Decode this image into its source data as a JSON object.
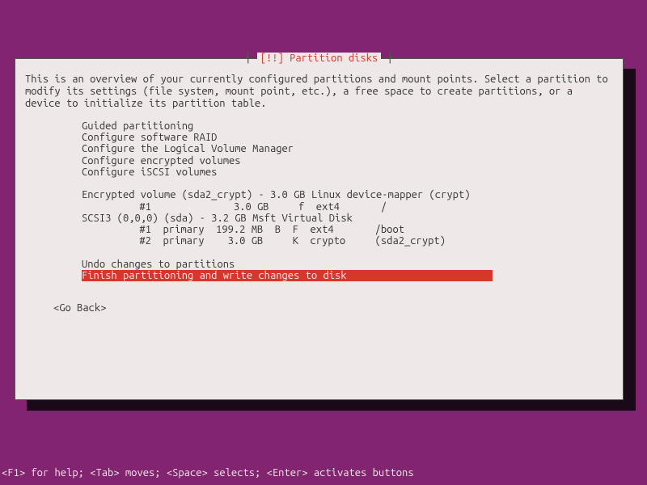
{
  "dialog": {
    "title": "[!!] Partition disks",
    "intro": "This is an overview of your currently configured partitions and mount points. Select a partition to modify its settings (file system, mount point, etc.), a free space to create partitions, or a device to initialize its partition table.",
    "menu1": {
      "guided": "Guided partitioning",
      "raid": "Configure software RAID",
      "lvm": "Configure the Logical Volume Manager",
      "encrypted": "Configure encrypted volumes",
      "iscsi": "Configure iSCSI volumes"
    },
    "disks": {
      "disk1_header": "Encrypted volume (sda2_crypt) - 3.0 GB Linux device-mapper (crypt)",
      "disk1_p1": "     #1              3.0 GB     f  ext4       /",
      "disk2_header": "SCSI3 (0,0,0) (sda) - 3.2 GB Msft Virtual Disk",
      "disk2_p1": "     #1  primary  199.2 MB  B  F  ext4       /boot",
      "disk2_p2": "     #2  primary    3.0 GB     K  crypto     (sda2_crypt)"
    },
    "menu2": {
      "undo": "Undo changes to partitions",
      "finish": "Finish partitioning and write changes to disk"
    },
    "go_back": "<Go Back>"
  },
  "footer": "<F1> for help; <Tab> moves; <Space> selects; <Enter> activates buttons"
}
